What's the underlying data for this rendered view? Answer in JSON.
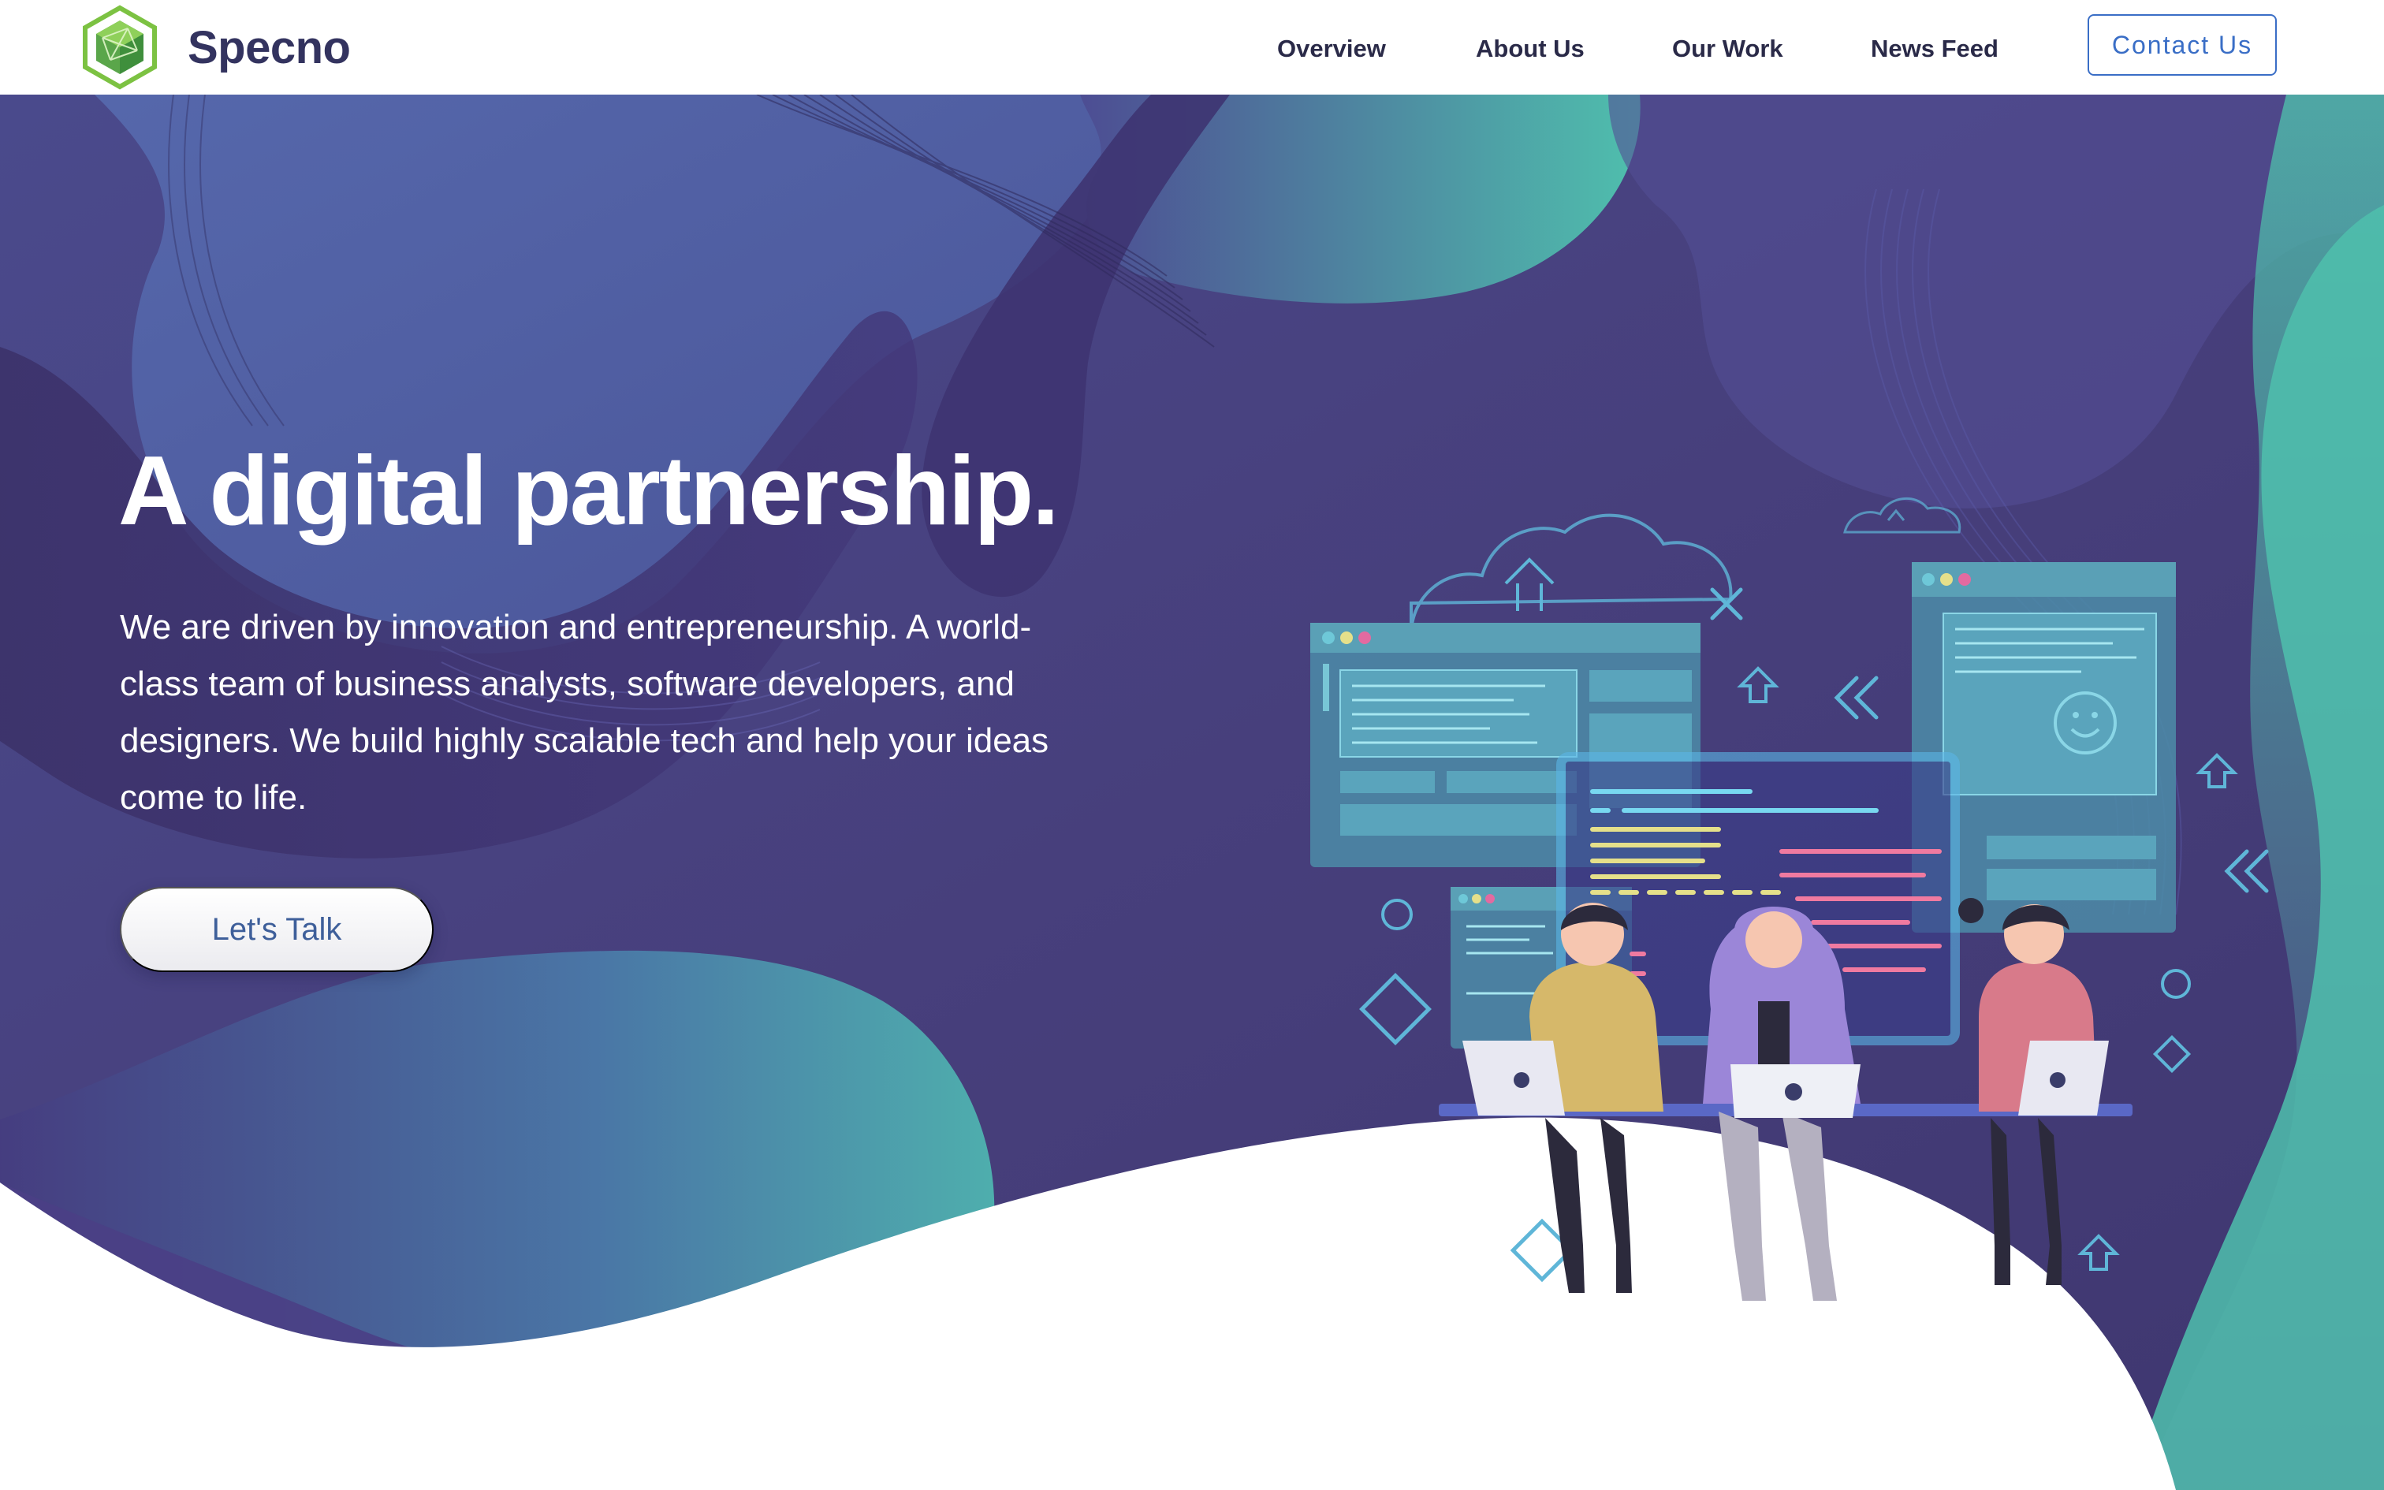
{
  "brand": {
    "name": "Specno"
  },
  "nav": {
    "items": [
      {
        "label": "Overview"
      },
      {
        "label": "About Us"
      },
      {
        "label": "Our Work"
      },
      {
        "label": "News Feed"
      }
    ],
    "contact_label": "Contact Us"
  },
  "hero": {
    "title": "A digital partnership.",
    "description": "We are driven by innovation and entrepreneurship. A world-class team of business analysts, software developers, and designers. We build highly scalable tech and help your ideas come to life.",
    "cta_label": "Let's Talk"
  },
  "colors": {
    "brand_dark": "#33335f",
    "accent_blue": "#3a6ec6",
    "hero_purple": "#463d7a",
    "hero_teal": "#4fb8a8",
    "logo_green": "#7cc242"
  },
  "icons": [
    "specno-hex-logo",
    "cloud-upload-icon",
    "close-x-icon",
    "chevron-double-left-icon",
    "arrow-up-house-icon",
    "smiley-icon",
    "diamond-shape-icon",
    "circle-shape-icon",
    "laptop-icon"
  ]
}
